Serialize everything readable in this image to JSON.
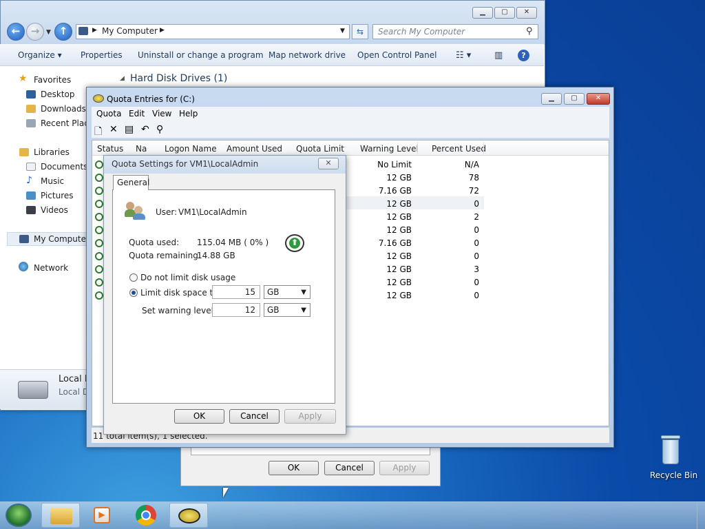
{
  "explorer": {
    "address": "My Computer",
    "search_placeholder": "Search My Computer",
    "commands": [
      "Organize",
      "Properties",
      "Uninstall or change a program",
      "Map network drive",
      "Open Control Panel"
    ],
    "nav": {
      "favorites": "Favorites",
      "desktop": "Desktop",
      "downloads": "Downloads",
      "recent": "Recent Places",
      "libraries": "Libraries",
      "documents": "Documents",
      "music": "Music",
      "pictures": "Pictures",
      "videos": "Videos",
      "computer": "My Computer",
      "network": "Network"
    },
    "group_header": "Hard Disk Drives (1)",
    "details_title": "Local Disk (C:)",
    "details_sub": "Local Disk"
  },
  "quota_window": {
    "title": "Quota Entries for  (C:)",
    "menu": [
      "Quota",
      "Edit",
      "View",
      "Help"
    ],
    "columns": [
      "Status",
      "Na",
      "Logon Name",
      "Amount Used",
      "Quota Limit",
      "Warning Level",
      "Percent Used"
    ],
    "rows": [
      {
        "warning": "No Limit",
        "percent": "N/A"
      },
      {
        "warning": "12 GB",
        "percent": "78"
      },
      {
        "warning": "7.16 GB",
        "percent": "72"
      },
      {
        "warning": "12 GB",
        "percent": "0"
      },
      {
        "warning": "12 GB",
        "percent": "2"
      },
      {
        "warning": "12 GB",
        "percent": "0"
      },
      {
        "warning": "7.16 GB",
        "percent": "0"
      },
      {
        "warning": "12 GB",
        "percent": "0"
      },
      {
        "warning": "12 GB",
        "percent": "3"
      },
      {
        "warning": "12 GB",
        "percent": "0"
      },
      {
        "warning": "12 GB",
        "percent": "0"
      }
    ],
    "status": "11 total item(s), 1 selected."
  },
  "settings_dialog": {
    "title": "Quota Settings for VM1\\LocalAdmin",
    "tab": "General",
    "user_label": "User:",
    "user_value": "VM1\\LocalAdmin",
    "quota_used_label": "Quota used:",
    "quota_used_value": "115.04 MB ( 0% )",
    "quota_remaining_label": "Quota remaining:",
    "quota_remaining_value": "14.88 GB",
    "no_limit_label": "Do not limit disk usage",
    "limit_label": "Limit disk space to",
    "limit_value": "15",
    "limit_unit": "GB",
    "warning_label": "Set warning level to",
    "warning_value": "12",
    "warning_unit": "GB",
    "ok": "OK",
    "cancel": "Cancel",
    "apply": "Apply"
  },
  "bg_dialog": {
    "ok": "OK",
    "cancel": "Cancel",
    "apply": "Apply"
  },
  "desktop": {
    "recycle_bin": "Recycle Bin"
  }
}
